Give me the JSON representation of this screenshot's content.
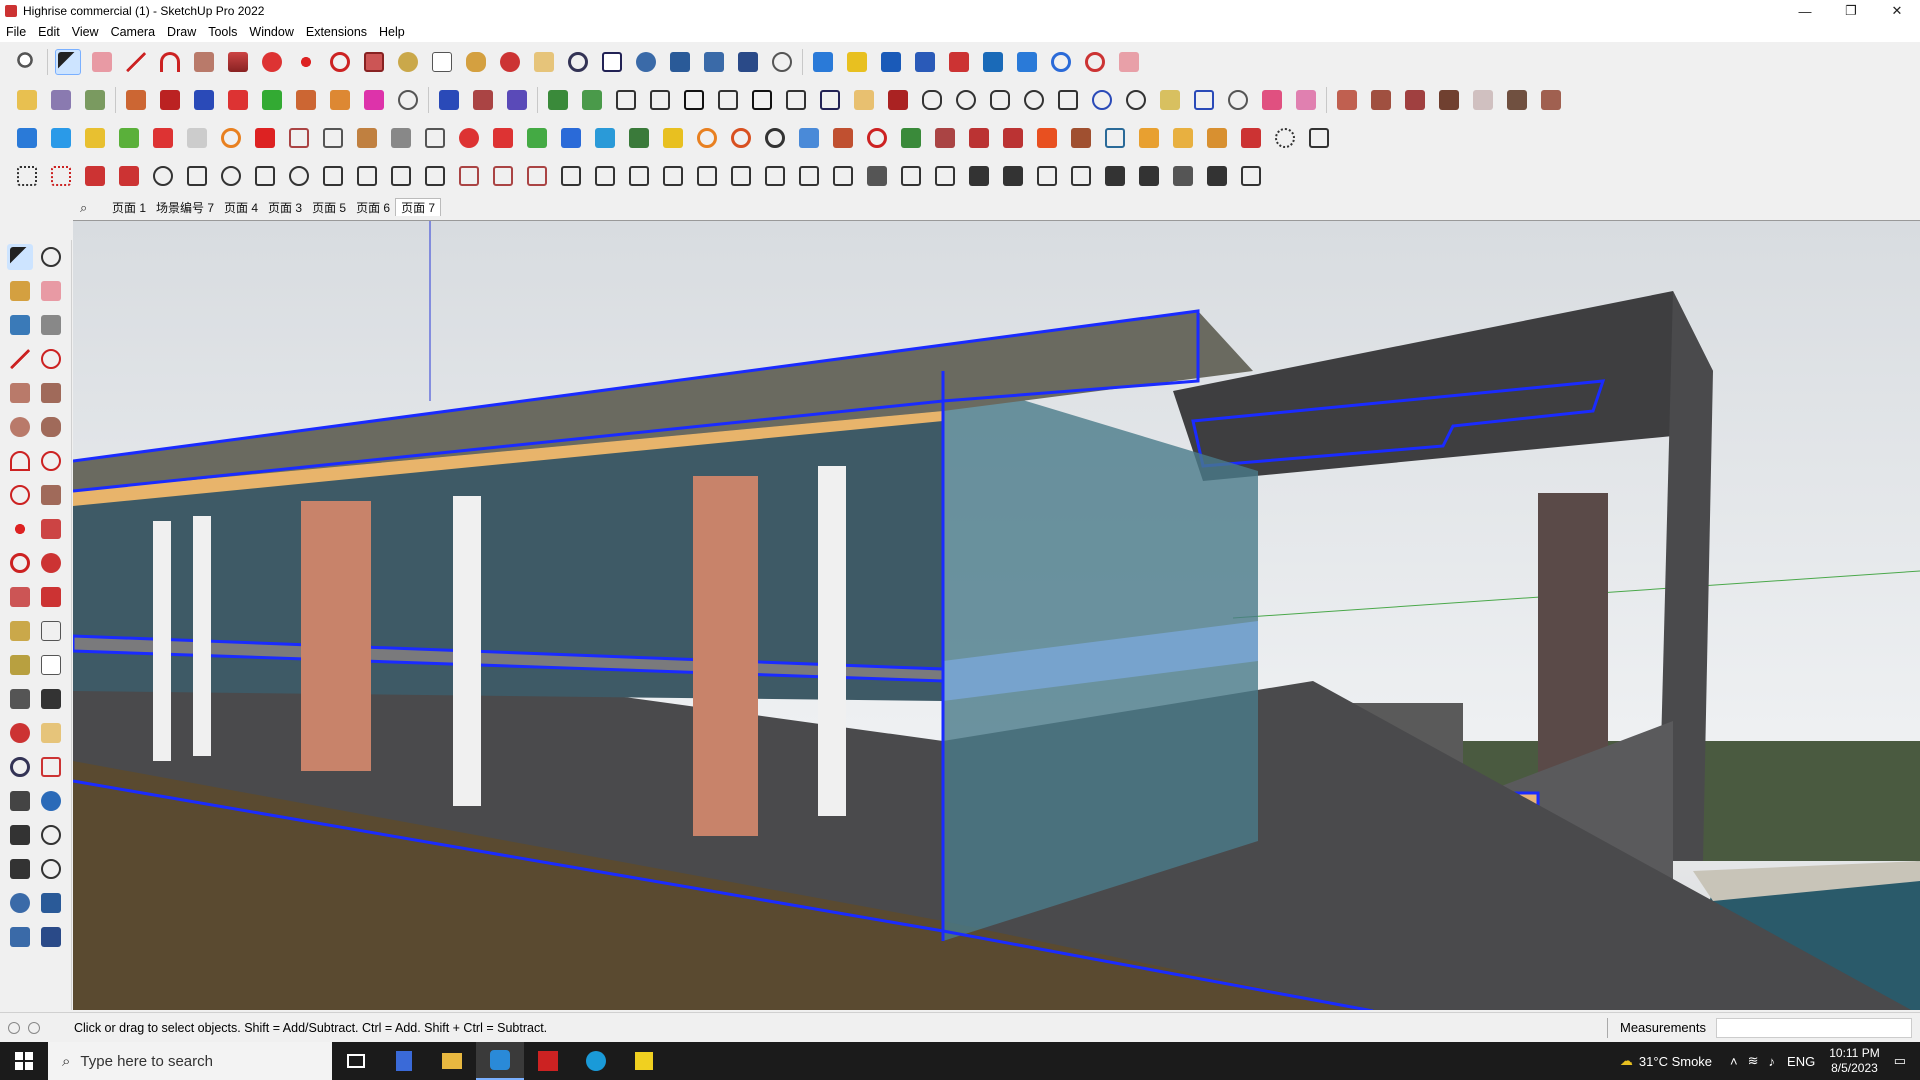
{
  "window": {
    "title": "Highrise commercial (1) - SketchUp Pro 2022",
    "minimize": "—",
    "maximize": "❐",
    "close": "✕"
  },
  "menu": [
    "File",
    "Edit",
    "View",
    "Camera",
    "Draw",
    "Tools",
    "Window",
    "Extensions",
    "Help"
  ],
  "scenes": {
    "tabs": [
      "页面 1",
      "场景编号 7",
      "页面 4",
      "页面 3",
      "页面 5",
      "页面 6",
      "页面 7"
    ],
    "active_index": 6
  },
  "status": {
    "message": "Click or drag to select objects. Shift = Add/Subtract. Ctrl = Add. Shift + Ctrl = Subtract.",
    "measurements_label": "Measurements",
    "measurements_value": ""
  },
  "taskbar": {
    "search_placeholder": "Type here to search",
    "weather": "31°C  Smoke",
    "language": "ENG",
    "time": "10:11 PM",
    "date": "8/5/2023"
  },
  "colors": {
    "selection_blue": "#1a2bff",
    "roof_wood": "#e8b46b",
    "terracotta": "#c8836a",
    "glass": "#5a8a9e"
  }
}
